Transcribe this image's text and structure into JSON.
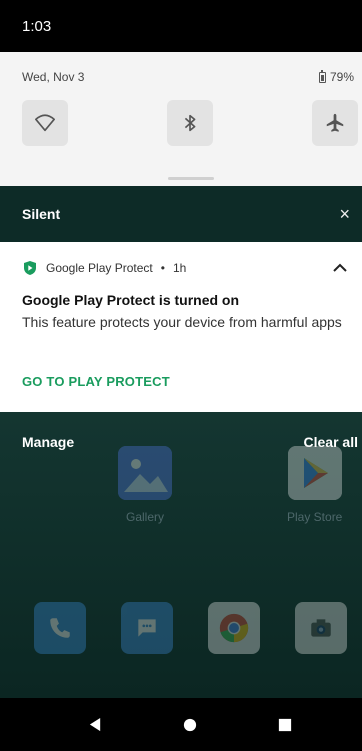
{
  "status_bar": {
    "time": "1:03"
  },
  "quick_settings": {
    "date": "Wed, Nov 3",
    "battery": "79%",
    "tiles": [
      {
        "name": "wifi",
        "icon": "wifi-icon"
      },
      {
        "name": "bluetooth",
        "icon": "bluetooth-icon"
      },
      {
        "name": "airplane",
        "icon": "airplane-icon"
      }
    ]
  },
  "silent_section": {
    "label": "Silent",
    "close_icon": "×"
  },
  "notification": {
    "app_name": "Google Play Protect",
    "separator": "•",
    "time": "1h",
    "title": "Google Play Protect is turned on",
    "body": "This feature protects your device from harmful apps",
    "action": "GO TO PLAY PROTECT",
    "accent_color": "#1a9c5e"
  },
  "manage_row": {
    "manage": "Manage",
    "clear_all": "Clear all"
  },
  "home_apps": [
    {
      "label": "Gallery"
    },
    {
      "label": "Play Store"
    }
  ]
}
